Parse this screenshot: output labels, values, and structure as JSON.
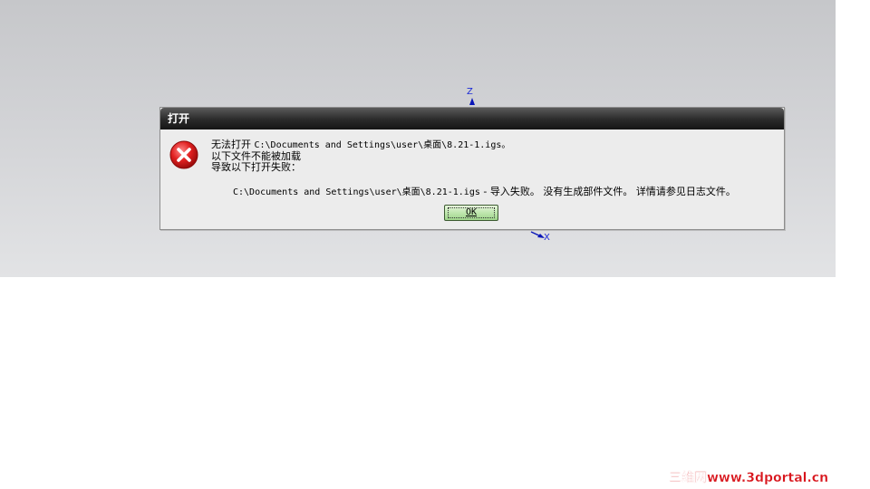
{
  "viewport": {
    "axis_z_label": "Z",
    "axis_x_label": "X"
  },
  "dialog": {
    "title": "打开",
    "icon": "error-icon",
    "message_line1_prefix": "无法打开 ",
    "message_line1_path": "C:\\Documents and Settings\\user\\桌面\\8.21-1.igs。",
    "message_line2": "以下文件不能被加载",
    "message_line3": "导致以下打开失败：",
    "detail_path": "C:\\Documents and Settings\\user\\桌面\\8.21-1.igs",
    "detail_message": " - 导入失败。 没有生成部件文件。 详情请参见日志文件。",
    "ok_label": "OK"
  },
  "watermark": {
    "text": "三维网www.3dportal.cn",
    "color": "#d8141b"
  }
}
